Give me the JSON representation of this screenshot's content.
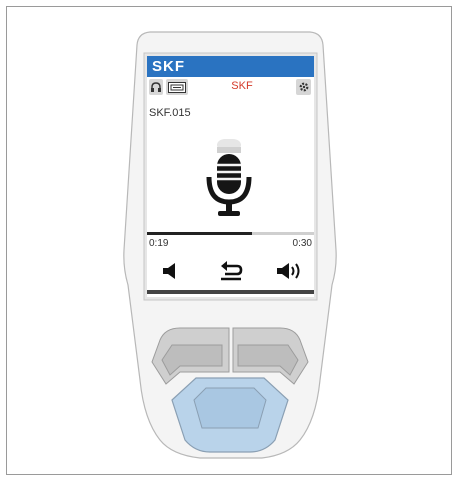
{
  "screen": {
    "brand": "SKF",
    "toolbar_title": "SKF",
    "track_name": "SKF.015",
    "elapsed": "0:19",
    "total": "0:30",
    "progress": 0.63
  },
  "icons": {
    "headphones": "headphones-icon",
    "card": "card-icon",
    "settings": "gear-icon",
    "mic": "microphone-icon",
    "volume_down": "volume-down-icon",
    "back": "back-icon",
    "volume_up": "volume-up-icon"
  },
  "colors": {
    "header": "#2a73c1",
    "title": "#d43a2a",
    "keypad_active": "#b9d3ea"
  }
}
